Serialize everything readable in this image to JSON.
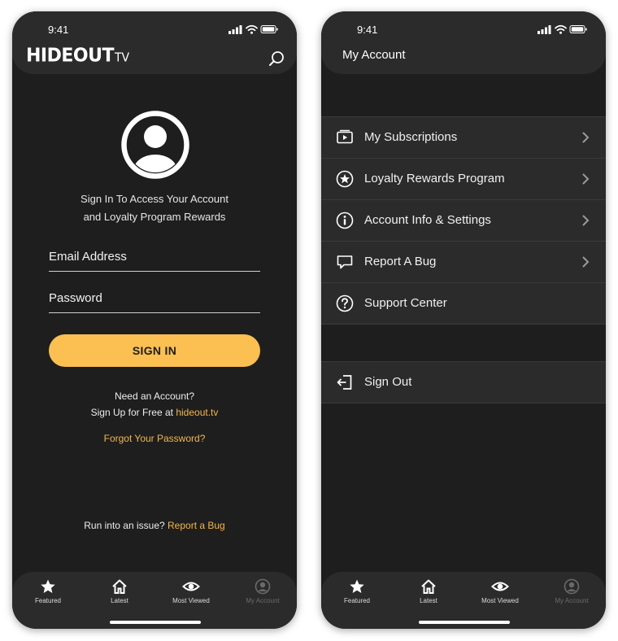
{
  "status_bar": {
    "time": "9:41"
  },
  "left_screen": {
    "logo": {
      "main": "HIDEOUT",
      "suffix": "TV"
    },
    "icons": {
      "search": "search-icon",
      "avatar": "user-avatar-icon"
    },
    "intro_line1": "Sign In To Access Your Account",
    "intro_line2": "and Loyalty Program Rewards",
    "email_placeholder": "Email Address",
    "password_placeholder": "Password",
    "signin_label": "SIGN IN",
    "need_account": "Need an Account?",
    "signup_prefix": "Sign Up for Free at",
    "signup_link": "hideout.tv",
    "forgot_password": "Forgot Your Password?",
    "issue_prefix": "Run into an issue?",
    "report_link": "Report a Bug"
  },
  "right_screen": {
    "title": "My Account",
    "menu": [
      {
        "label": "My Subscriptions",
        "icon": "play-screen-icon",
        "has_chevron": true
      },
      {
        "label": "Loyalty Rewards Program",
        "icon": "star-circle-icon",
        "has_chevron": true
      },
      {
        "label": "Account Info & Settings",
        "icon": "info-circle-icon",
        "has_chevron": true
      },
      {
        "label": "Report A Bug",
        "icon": "chat-bubble-icon",
        "has_chevron": true
      },
      {
        "label": "Support Center",
        "icon": "question-circle-icon",
        "has_chevron": false
      }
    ],
    "sign_out": {
      "label": "Sign Out",
      "icon": "sign-out-icon"
    }
  },
  "tab_bar": [
    {
      "label": "Featured",
      "icon": "star-icon",
      "active": true
    },
    {
      "label": "Latest",
      "icon": "home-icon",
      "active": true
    },
    {
      "label": "Most Viewed",
      "icon": "eye-icon",
      "active": true
    },
    {
      "label": "My Account",
      "icon": "account-icon",
      "active": false
    }
  ],
  "colors": {
    "background": "#1e1e1e",
    "panel": "#2b2b2b",
    "accent": "#fbbf52",
    "link": "#f3b74a",
    "inactive_tab": "#6a6a6a"
  }
}
